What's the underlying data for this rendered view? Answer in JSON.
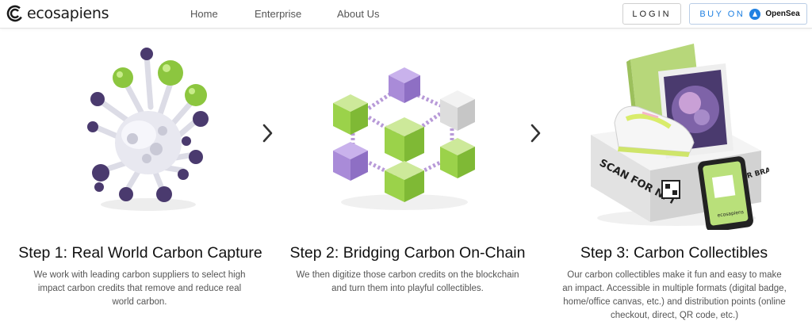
{
  "header": {
    "logo_text": "ecosapiens",
    "nav": [
      "Home",
      "Enterprise",
      "About Us"
    ],
    "login_label": "LOGIN",
    "buy_label": "BUY ON",
    "opensea_label": "OpenSea"
  },
  "steps": [
    {
      "title": "Step 1: Real World Carbon Capture",
      "description": "We work with leading carbon suppliers to select high impact carbon credits that remove and reduce real world carbon.",
      "illustration": "molecule-illustration"
    },
    {
      "title": "Step 2: Bridging Carbon On-Chain",
      "description": "We then digitize those carbon credits on the blockchain and turn them into playful collectibles.",
      "illustration": "blockchain-cubes-illustration"
    },
    {
      "title": "Step 3: Carbon Collectibles",
      "description": "Our carbon collectibles make it fun and easy to make an impact. Accessible in multiple formats (digital badge, home/office canvas, etc.) and distribution points (online checkout, direct, QR code, etc.)",
      "illustration": "collectibles-illustration",
      "box_text": "SCAN FOR NFT",
      "box_side_text": "PARTNER BRANDS",
      "phone_text": "ecosapiens"
    }
  ],
  "icons": {
    "next": "chevron-right-icon",
    "opensea": "opensea-logo-icon"
  },
  "colors": {
    "opensea_blue": "#2081e2",
    "molecule_green": "#8cc63f",
    "molecule_purple": "#4a3a6e",
    "cube_purple": "#a98bd8",
    "cube_green": "#9bd24a"
  }
}
